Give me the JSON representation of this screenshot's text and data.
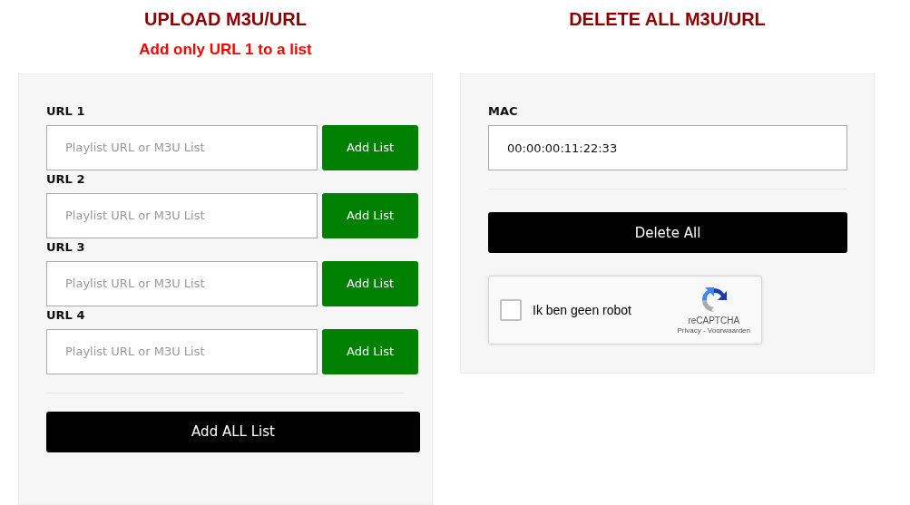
{
  "upload": {
    "title": "UPLOAD M3U/URL",
    "subtitle": "Add only URL 1 to a list",
    "urls": [
      {
        "label": "URL 1",
        "placeholder": "Playlist URL or M3U List",
        "button": "Add List"
      },
      {
        "label": "URL 2",
        "placeholder": "Playlist URL or M3U List",
        "button": "Add List"
      },
      {
        "label": "URL 3",
        "placeholder": "Playlist URL or M3U List",
        "button": "Add List"
      },
      {
        "label": "URL 4",
        "placeholder": "Playlist URL or M3U List",
        "button": "Add List"
      }
    ],
    "submit": "Add ALL List"
  },
  "delete": {
    "title": "DELETE ALL M3U/URL",
    "mac_label": "MAC",
    "mac_value": "00:00:00:11:22:33",
    "submit": "Delete All",
    "captcha": {
      "checked": false,
      "label": "Ik ben geen robot",
      "brand": "reCAPTCHA",
      "links": "Privacy - Voorwaarden"
    }
  }
}
